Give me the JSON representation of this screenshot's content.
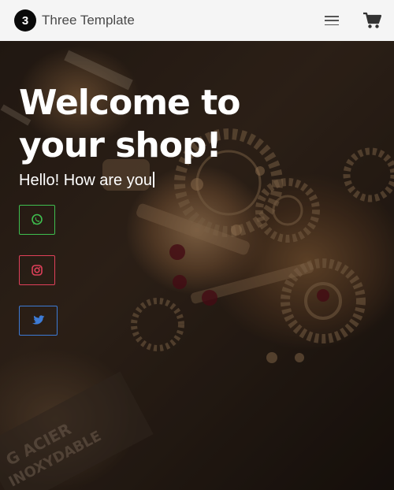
{
  "navbar": {
    "logo_text": "3",
    "brand_name": "Three Template",
    "menu_icon": "hamburger-menu-icon",
    "cart_icon": "shopping-cart-icon"
  },
  "hero": {
    "title": "Welcome to your shop!",
    "subtitle": "Hello! How are you",
    "social": [
      {
        "name": "whatsapp",
        "icon": "whatsapp-icon",
        "color": "#3fbf4f"
      },
      {
        "name": "instagram",
        "icon": "instagram-icon",
        "color": "#e0405a"
      },
      {
        "name": "twitter",
        "icon": "twitter-icon",
        "color": "#3d7bd6"
      }
    ]
  },
  "colors": {
    "navbar_bg": "#f5f5f5",
    "title_text": "#ffffff"
  }
}
